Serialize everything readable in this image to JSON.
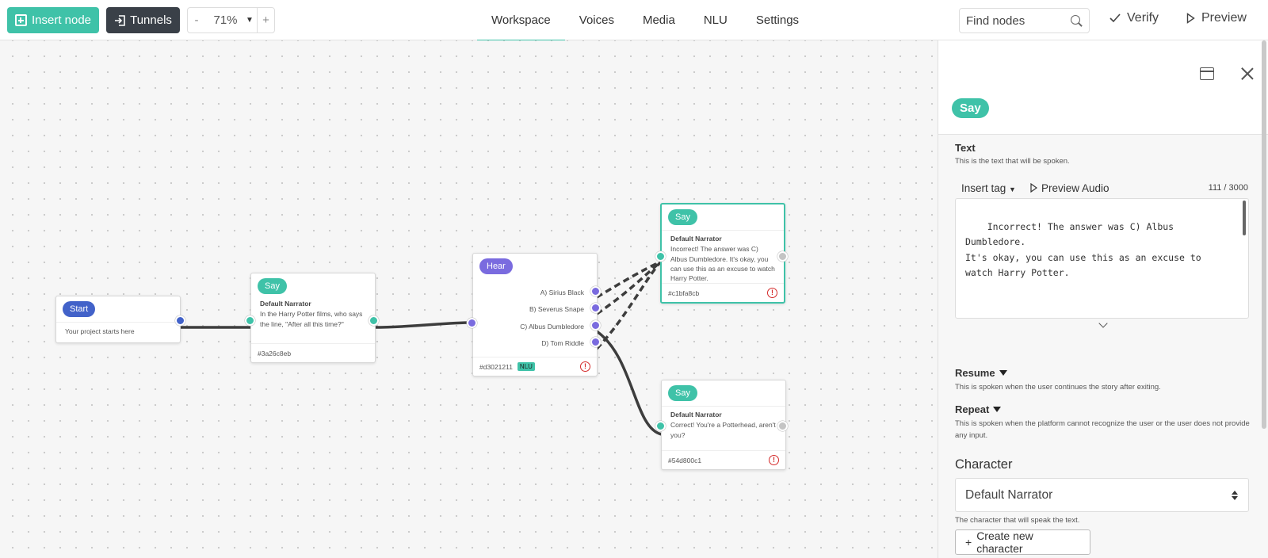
{
  "toolbar": {
    "insert_node": "Insert node",
    "tunnels": "Tunnels",
    "zoom_minus": "-",
    "zoom_value": "71%",
    "zoom_plus": "+",
    "search_placeholder": "Find nodes",
    "verify": "Verify",
    "preview": "Preview"
  },
  "tabs": [
    {
      "label": "Workspace",
      "active": true
    },
    {
      "label": "Voices",
      "active": false
    },
    {
      "label": "Media",
      "active": false
    },
    {
      "label": "NLU",
      "active": false
    },
    {
      "label": "Settings",
      "active": false
    }
  ],
  "nodes": {
    "start": {
      "type": "Start",
      "text": "Your project starts here"
    },
    "say1": {
      "type": "Say",
      "character": "Default Narrator",
      "text": "In the Harry Potter films, who says the line, \"After all this time?\"",
      "id": "#3a26c8eb"
    },
    "hear": {
      "type": "Hear",
      "choices": [
        "A) Sirius Black",
        "B) Severus Snape",
        "C) Albus Dumbledore",
        "D) Tom Riddle"
      ],
      "id": "#d3021211",
      "badge": "NLU"
    },
    "say2": {
      "type": "Say",
      "character": "Default Narrator",
      "text": "Incorrect! The answer was C) Albus Dumbledore. It's okay, you can use this as an excuse to watch Harry Potter.",
      "id": "#c1bfa8cb"
    },
    "say3": {
      "type": "Say",
      "character": "Default Narrator",
      "text": "Correct! You're a Potterhead, aren't you?",
      "id": "#54d800c1"
    }
  },
  "panel": {
    "badge": "Say",
    "text_label": "Text",
    "text_help": "This is the text that will be spoken.",
    "insert_tag": "Insert tag",
    "preview_audio": "Preview Audio",
    "char_count": "111 / 3000",
    "text_value": "Incorrect! The answer was C) Albus Dumbledore.\nIt's okay, you can use this as an excuse to\nwatch Harry Potter.",
    "resume_label": "Resume",
    "resume_help": "This is spoken when the user continues the story after exiting.",
    "repeat_label": "Repeat",
    "repeat_help": "This is spoken when the platform cannot recognize the user or the user does not provide any input.",
    "character_title": "Character",
    "character_value": "Default Narrator",
    "character_help": "The character that will speak the text.",
    "create_character": "Create new character"
  },
  "colors": {
    "accent": "#3fc2a8",
    "start": "#4262c9",
    "hear": "#7a6bdf",
    "dark_button": "#3a4048",
    "warning": "#d42a2a"
  },
  "icons": [
    "plus-square-icon",
    "tunnel-icon",
    "search-icon",
    "check-icon",
    "play-icon",
    "window-icon",
    "close-icon",
    "warning-icon",
    "chevron-down-icon"
  ]
}
